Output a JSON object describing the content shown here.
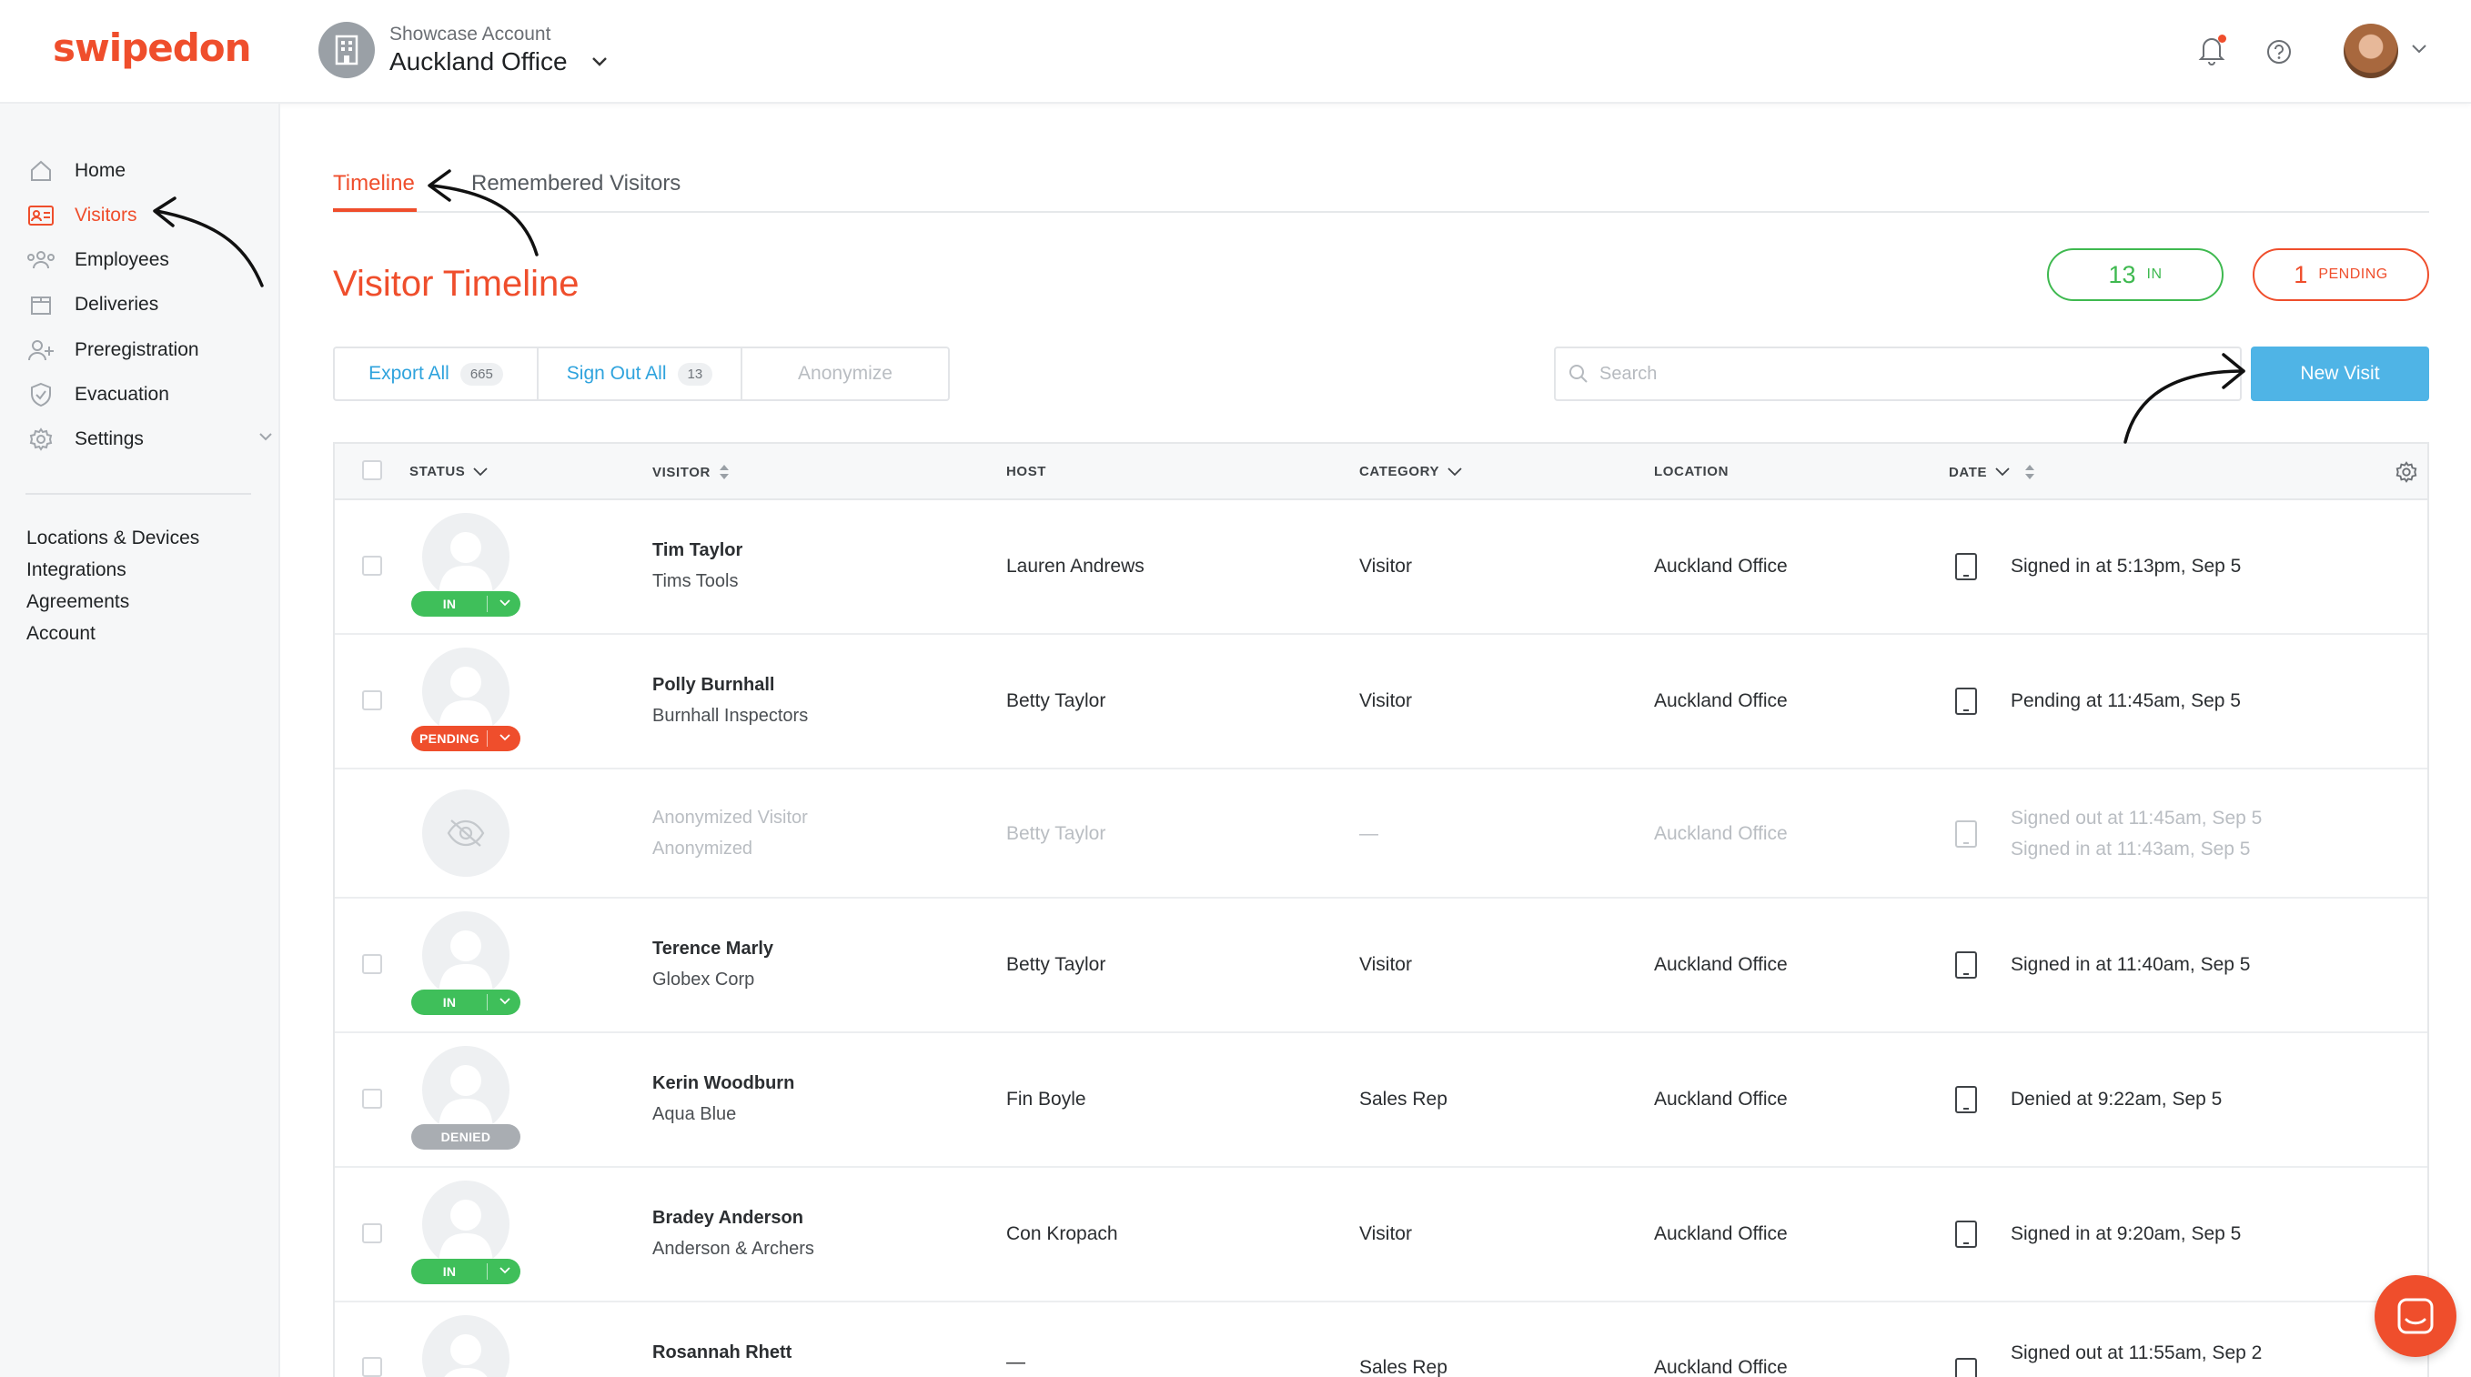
{
  "app": {
    "logo": "swipedon"
  },
  "account": {
    "subtitle": "Showcase Account",
    "title": "Auckland Office"
  },
  "sidebar": {
    "items": [
      {
        "label": "Home",
        "icon": "home-icon"
      },
      {
        "label": "Visitors",
        "icon": "visitor-card-icon",
        "active": true
      },
      {
        "label": "Employees",
        "icon": "employees-icon"
      },
      {
        "label": "Deliveries",
        "icon": "box-icon"
      },
      {
        "label": "Preregistration",
        "icon": "user-plus-icon"
      },
      {
        "label": "Evacuation",
        "icon": "shield-check-icon"
      },
      {
        "label": "Settings",
        "icon": "gear-icon"
      }
    ],
    "links": [
      "Locations & Devices",
      "Integrations",
      "Agreements",
      "Account"
    ]
  },
  "tabs": {
    "timeline": "Timeline",
    "remembered": "Remembered Visitors"
  },
  "page": {
    "title": "Visitor Timeline"
  },
  "counters": {
    "in": {
      "count": "13",
      "label": "IN",
      "color": "#3fb950"
    },
    "pending": {
      "count": "1",
      "label": "PENDING",
      "color": "#ef4e2c"
    }
  },
  "actions": {
    "export_label": "Export All",
    "export_count": "665",
    "signout_label": "Sign Out All",
    "signout_count": "13",
    "anonymize_label": "Anonymize"
  },
  "search": {
    "placeholder": "Search"
  },
  "new_visit_label": "New Visit",
  "table": {
    "headers": {
      "status": "STATUS",
      "visitor": "VISITOR",
      "host": "HOST",
      "category": "CATEGORY",
      "location": "LOCATION",
      "date": "DATE"
    },
    "rows": [
      {
        "status": "IN",
        "name": "Tim Taylor",
        "company": "Tims Tools",
        "host": "Lauren Andrews",
        "category": "Visitor",
        "location": "Auckland Office",
        "date": "Signed in at 5:13pm, Sep 5"
      },
      {
        "status": "PENDING",
        "name": "Polly Burnhall",
        "company": "Burnhall Inspectors",
        "host": "Betty Taylor",
        "category": "Visitor",
        "location": "Auckland Office",
        "date": "Pending at 11:45am, Sep 5"
      },
      {
        "status": "",
        "name": "Anonymized Visitor",
        "company": "Anonymized",
        "host": "Betty Taylor",
        "category": "—",
        "location": "Auckland Office",
        "date": "Signed out at 11:45am, Sep 5",
        "date2": "Signed in at 11:43am, Sep 5"
      },
      {
        "status": "IN",
        "name": "Terence Marly",
        "company": "Globex Corp",
        "host": "Betty Taylor",
        "category": "Visitor",
        "location": "Auckland Office",
        "date": "Signed in at 11:40am, Sep 5"
      },
      {
        "status": "DENIED",
        "name": "Kerin Woodburn",
        "company": "Aqua Blue",
        "host": "Fin Boyle",
        "category": "Sales Rep",
        "location": "Auckland Office",
        "date": "Denied at 9:22am, Sep 5"
      },
      {
        "status": "IN",
        "name": "Bradey Anderson",
        "company": "Anderson & Archers",
        "host": "Con Kropach",
        "category": "Visitor",
        "location": "Auckland Office",
        "date": "Signed in at 9:20am, Sep 5"
      },
      {
        "status": "",
        "name": "Rosannah Rhett",
        "company": "",
        "host": "—",
        "category": "Sales Rep",
        "location": "Auckland Office",
        "date": "Signed out at 11:55am, Sep 2"
      }
    ]
  },
  "colors": {
    "brand": "#ef4e2c",
    "accent_blue": "#4fb4e6",
    "in_green": "#3fbf5a",
    "denied_grey": "#a9adb2"
  }
}
